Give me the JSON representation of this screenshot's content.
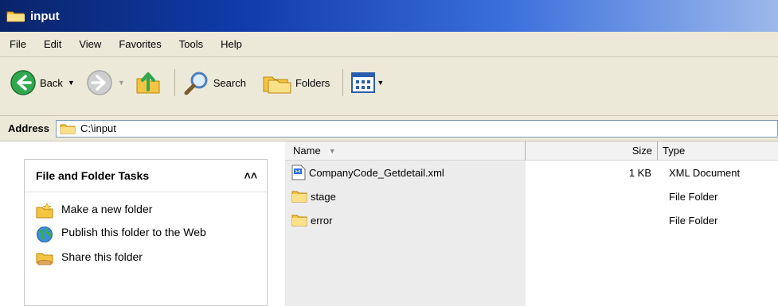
{
  "window": {
    "title": "input"
  },
  "menu": [
    "File",
    "Edit",
    "View",
    "Favorites",
    "Tools",
    "Help"
  ],
  "toolbar": {
    "back_label": "Back",
    "search_label": "Search",
    "folders_label": "Folders"
  },
  "address": {
    "label": "Address",
    "value": "C:\\input"
  },
  "tasks": {
    "title": "File and Folder Tasks",
    "collapse_glyph": "˄",
    "items": [
      {
        "label": "Make a new folder",
        "icon": "new-folder-icon"
      },
      {
        "label": "Publish this folder to the Web",
        "icon": "publish-web-icon"
      },
      {
        "label": "Share this folder",
        "icon": "share-folder-icon"
      }
    ]
  },
  "files": {
    "columns": {
      "name": "Name",
      "size": "Size",
      "type": "Type"
    },
    "rows": [
      {
        "name": "CompanyCode_Getdetail.xml",
        "size": "1 KB",
        "type": "XML Document",
        "icon": "xml-file-icon"
      },
      {
        "name": "stage",
        "size": "",
        "type": "File Folder",
        "icon": "folder-icon"
      },
      {
        "name": "error",
        "size": "",
        "type": "File Folder",
        "icon": "folder-icon"
      }
    ]
  },
  "colors": {
    "title_gradient_start": "#0a246a",
    "chrome": "#ece9d8",
    "folder_yellow": "#f6d365"
  }
}
